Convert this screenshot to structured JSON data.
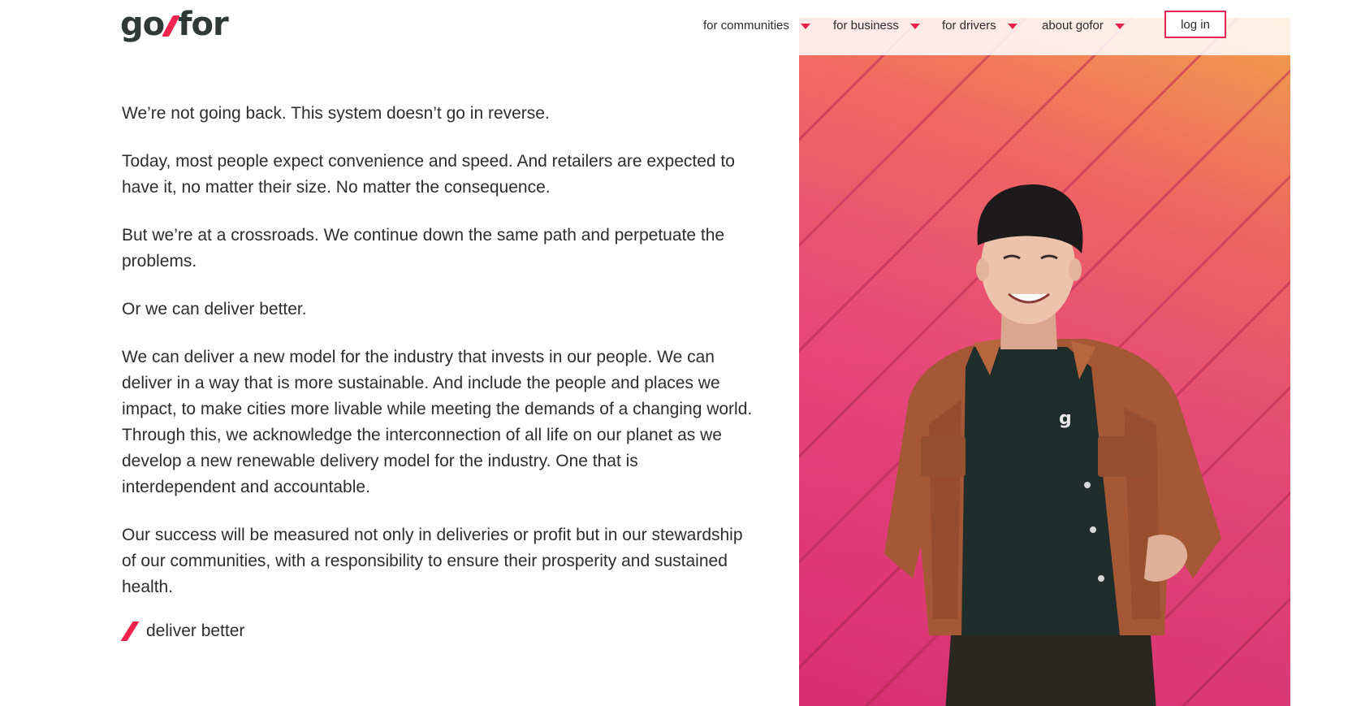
{
  "brand": {
    "logo_left": "go",
    "logo_right": "for",
    "accent_color": "#f0244f",
    "text_color": "#2f3a36"
  },
  "nav": {
    "items": [
      {
        "label": "for communities"
      },
      {
        "label": "for business"
      },
      {
        "label": "for drivers"
      },
      {
        "label": "about gofor"
      }
    ],
    "login_label": "log in"
  },
  "content": {
    "paragraphs": [
      "We’re not going back.  This system doesn’t go in reverse.",
      "Today, most people expect convenience and speed. And retailers are expected to have it, no matter their size.  No matter the consequence.",
      "But we’re at a crossroads. We continue down the same path and perpetuate the problems.",
      "Or we can deliver better.",
      "We can deliver a new model for the industry that invests in our people. We can deliver in a way that is more sustainable.  And include the people and places we impact, to make cities more livable while meeting the demands of a changing world.  Through this, we acknowledge the interconnection of all life on our planet as we develop a new renewable delivery model for the industry.  One that is interdependent and accountable.",
      "Our success will be measured not only in deliveries or profit but in our stewardship of our communities, with a responsibility to ensure their prosperity and sustained health."
    ],
    "tagline": "deliver better"
  },
  "hero": {
    "shirt_mark": "g"
  }
}
